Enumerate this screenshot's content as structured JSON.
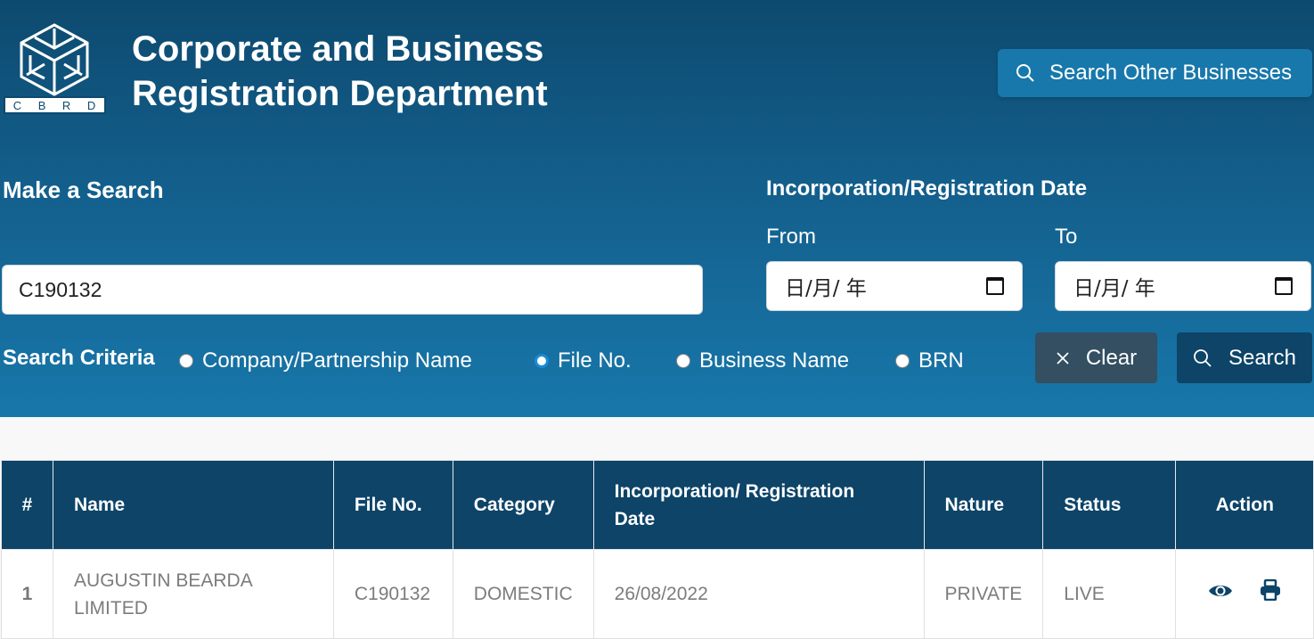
{
  "header": {
    "logo_letters": [
      "C",
      "B",
      "R",
      "D"
    ],
    "title_line1": "Corporate and Business",
    "title_line2": "Registration Department",
    "other_button_label": "Search Other Businesses",
    "other_button_icon": "search-icon"
  },
  "search": {
    "section_title": "Make a Search",
    "query_value": "C190132",
    "criteria_label": "Search Criteria",
    "criteria_options": [
      {
        "label": "Company/Partnership Name",
        "checked": false
      },
      {
        "label": "File No.",
        "checked": true
      },
      {
        "label": "Business Name",
        "checked": false
      },
      {
        "label": "BRN",
        "checked": false
      }
    ],
    "date_section_title": "Incorporation/Registration Date",
    "from_label": "From",
    "to_label": "To",
    "from_value": "日/月/ 年",
    "to_value": "日/月/ 年",
    "clear_label": "Clear",
    "clear_icon": "close-icon",
    "search_label": "Search",
    "search_icon": "search-icon"
  },
  "table": {
    "columns": [
      "#",
      "Name",
      "File No.",
      "Category",
      "Incorporation/ Registration Date",
      "Nature",
      "Status",
      "Action"
    ],
    "rows": [
      {
        "index": "1",
        "name": "AUGUSTIN BEARDA LIMITED",
        "file_no": "C190132",
        "category": "DOMESTIC",
        "date": "26/08/2022",
        "nature": "PRIVATE",
        "status": "LIVE",
        "actions": [
          "eye-icon",
          "print-icon"
        ]
      }
    ]
  },
  "colors": {
    "header_top": "#0d4a6f",
    "header_bottom": "#1877aa",
    "table_header": "#0d4468",
    "accent_button": "#1878ab",
    "clear_button": "#334f61"
  }
}
